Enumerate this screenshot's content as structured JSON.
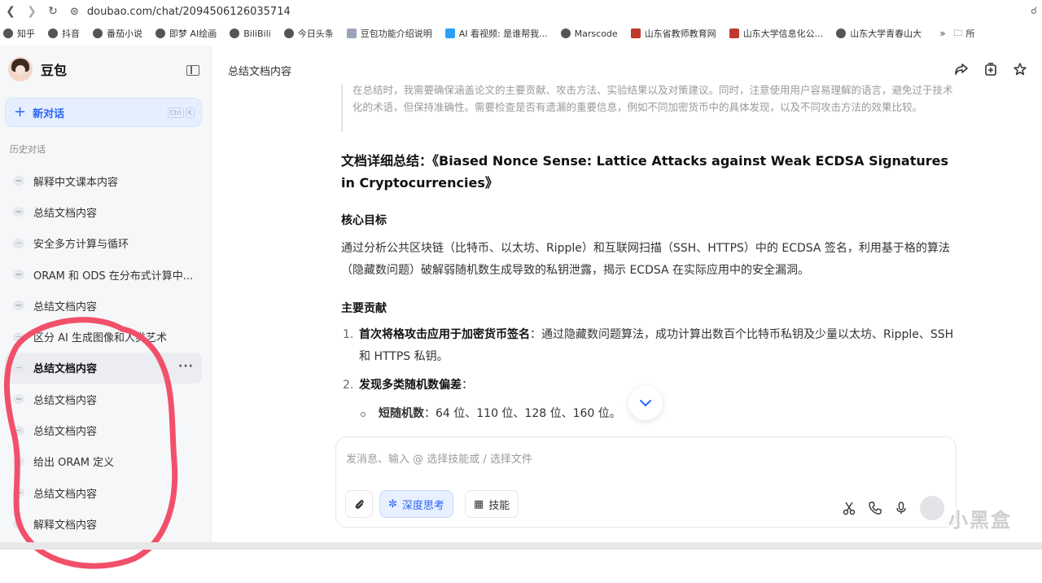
{
  "browser": {
    "url": "doubao.com/chat/2094506126035714",
    "bookmarks": [
      {
        "label": "知乎",
        "icon": "globe-icon"
      },
      {
        "label": "抖音",
        "icon": "globe-icon"
      },
      {
        "label": "番茄小说",
        "icon": "globe-icon"
      },
      {
        "label": "即梦 AI绘画",
        "icon": "globe-icon"
      },
      {
        "label": "BiliBili",
        "icon": "globe-icon"
      },
      {
        "label": "今日头条",
        "icon": "globe-icon"
      },
      {
        "label": "豆包功能介绍说明",
        "icon": "doc-icon"
      },
      {
        "label": "AI 看视频: 是谁帮我...",
        "icon": "tv-icon"
      },
      {
        "label": "Marscode",
        "icon": "globe-icon"
      },
      {
        "label": "山东省教师教育网",
        "icon": "site-icon"
      },
      {
        "label": "山东大学信息化公...",
        "icon": "site-icon"
      },
      {
        "label": "山东大学青春山大",
        "icon": "globe-icon"
      }
    ],
    "more": "»",
    "folder_label": "所"
  },
  "sidebar": {
    "brand": "豆包",
    "new_chat": "新对话",
    "shortcut": [
      "Ctrl",
      "K"
    ],
    "history_title": "历史对话",
    "items": [
      {
        "label": "解释中文课本内容"
      },
      {
        "label": "总结文档内容"
      },
      {
        "label": "安全多方计算与循环"
      },
      {
        "label": "ORAM 和 ODS 在分布式计算中..."
      },
      {
        "label": "总结文档内容"
      },
      {
        "label": "区分 AI 生成图像和人类艺术"
      },
      {
        "label": "总结文档内容",
        "active": true,
        "more": "···"
      },
      {
        "label": "总结文档内容"
      },
      {
        "label": "总结文档内容"
      },
      {
        "label": "给出 ORAM 定义"
      },
      {
        "label": "总结文档内容"
      },
      {
        "label": "解释文档内容"
      }
    ]
  },
  "main": {
    "chat_title": "总结文档内容",
    "thinking": "在总结时，我需要确保涵盖论文的主要贡献、攻击方法、实验结果以及对策建议。同时，注意使用用户容易理解的语言，避免过于技术化的术语，但保持准确性。需要检查是否有遗漏的重要信息，例如不同加密货币中的具体发现，以及不同攻击方法的效果比较。",
    "doc_title": "文档详细总结：《Biased Nonce Sense: Lattice Attacks against Weak ECDSA Signatures in Cryptocurrencies》",
    "goal_heading": "核心目标",
    "goal_text": "通过分析公共区块链（比特币、以太坊、Ripple）和互联网扫描（SSH、HTTPS）中的 ECDSA 签名，利用基于格的算法（隐藏数问题）破解弱随机数生成导致的私钥泄露，揭示 ECDSA 在实际应用中的安全漏洞。",
    "contrib_heading": "主要贡献",
    "contribs": [
      {
        "num": "1.",
        "bold": "首次将格攻击应用于加密货币签名",
        "text": "：通过隐藏数问题算法，成功计算出数百个比特币私钥及少量以太坊、Ripple、SSH 和 HTTPS 私钥。"
      },
      {
        "num": "2.",
        "bold": "发现多类随机数偏差",
        "text": "："
      }
    ],
    "sub_item": {
      "bold": "短随机数",
      "text": "：64 位、110 位、128 位、160 位。"
    }
  },
  "composer": {
    "placeholder": "发消息、输入 @ 选择技能或 / 选择文件",
    "deep_think": "深度思考",
    "skills": "技能"
  },
  "watermark": "小黑盒",
  "colors": {
    "accent": "#2a64f6",
    "annotation": "#f2506a"
  }
}
